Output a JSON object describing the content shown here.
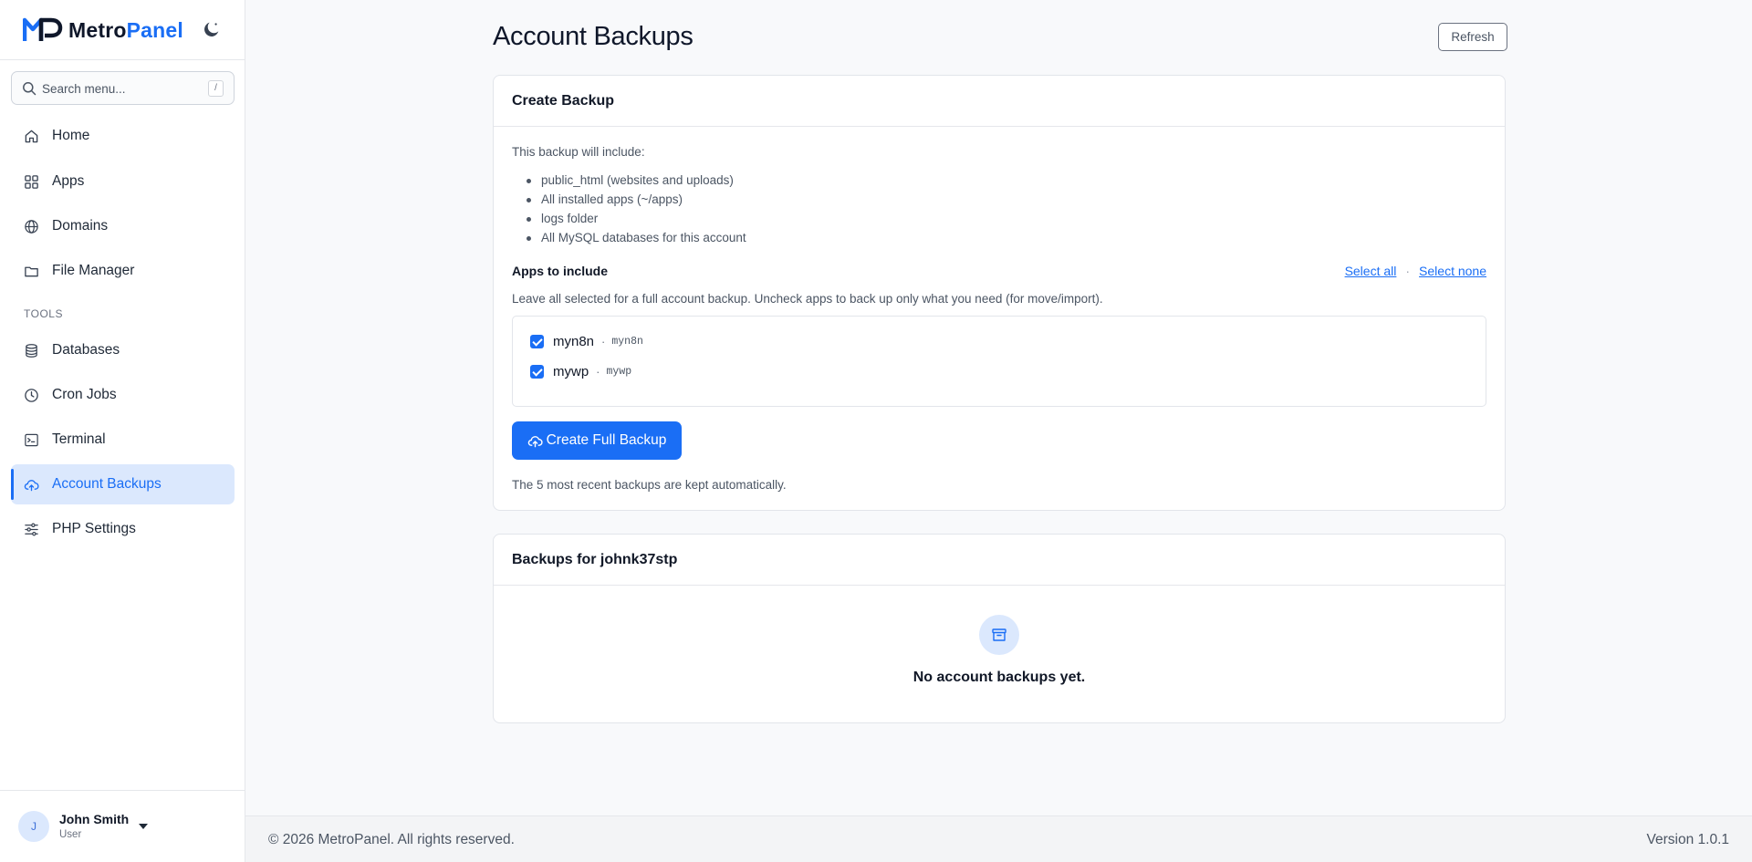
{
  "brand": {
    "name_part1": "Metro",
    "name_part2": "Panel",
    "theme_toggle_icon": "moon-icon"
  },
  "search": {
    "placeholder": "Search menu...",
    "shortcut": "/"
  },
  "sidebar": {
    "items": [
      {
        "label": "Home",
        "icon": "home-icon"
      },
      {
        "label": "Apps",
        "icon": "grid-icon"
      },
      {
        "label": "Domains",
        "icon": "globe-icon"
      },
      {
        "label": "File Manager",
        "icon": "folder-icon"
      }
    ],
    "tools_label": "TOOLS",
    "tools": [
      {
        "label": "Databases",
        "icon": "database-icon"
      },
      {
        "label": "Cron Jobs",
        "icon": "clock-icon"
      },
      {
        "label": "Terminal",
        "icon": "terminal-icon"
      },
      {
        "label": "Account Backups",
        "icon": "cloud-upload-icon",
        "active": true
      },
      {
        "label": "PHP Settings",
        "icon": "sliders-icon"
      }
    ]
  },
  "user": {
    "initial": "J",
    "name": "John Smith",
    "role": "User"
  },
  "header": {
    "title": "Account Backups",
    "refresh_label": "Refresh"
  },
  "create_card": {
    "title": "Create Backup",
    "intro": "This backup will include:",
    "includes": [
      "public_html (websites and uploads)",
      "All installed apps (~/apps)",
      "logs folder",
      "All MySQL databases for this account"
    ],
    "apps_heading": "Apps to include",
    "select_all": "Select all",
    "select_sep": "·",
    "select_none": "Select none",
    "apps_help": "Leave all selected for a full account backup. Uncheck apps to back up only what you need (for move/import).",
    "apps": [
      {
        "name": "myn8n",
        "sep": "·",
        "slug": "myn8n",
        "checked": true
      },
      {
        "name": "mywp",
        "sep": "·",
        "slug": "mywp",
        "checked": true
      }
    ],
    "button_label": "Create Full Backup",
    "retention_note": "The 5 most recent backups are kept automatically."
  },
  "backups_card": {
    "title": "Backups for johnk37stp",
    "empty_icon": "archive-icon",
    "empty_text": "No account backups yet."
  },
  "footer": {
    "copyright": "© 2026 MetroPanel. All rights reserved.",
    "version": "Version 1.0.1"
  },
  "colors": {
    "accent": "#1a6ef5",
    "active_bg": "#dbe8fd",
    "page_bg": "#f8f9fb"
  }
}
